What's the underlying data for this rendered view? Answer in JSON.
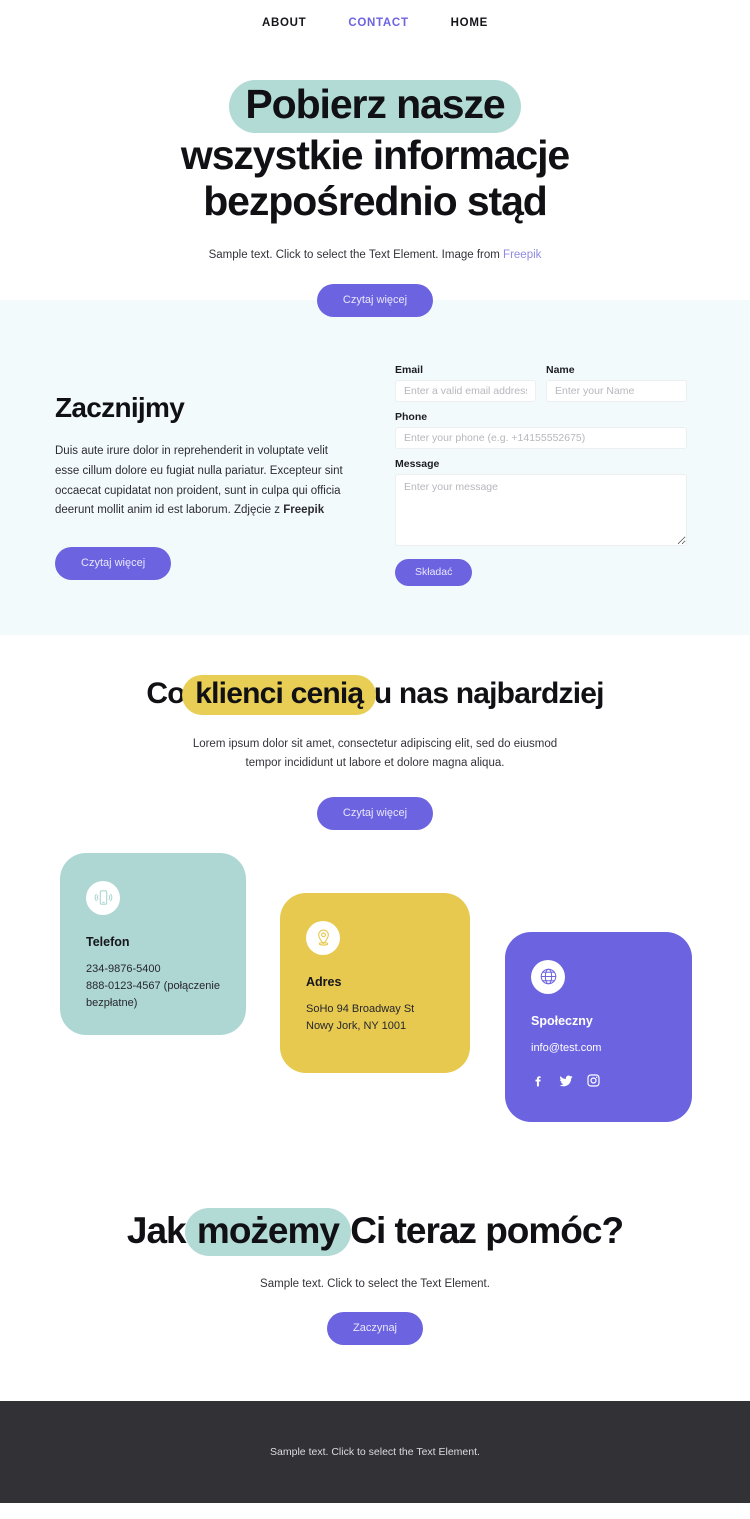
{
  "nav": {
    "items": [
      {
        "label": "ABOUT",
        "active": false
      },
      {
        "label": "CONTACT",
        "active": true
      },
      {
        "label": "HOME",
        "active": false
      }
    ]
  },
  "hero": {
    "title_highlight": "Pobierz nasze",
    "title_rest": "wszystkie informacje bezpośrednio stąd",
    "subtitle": "Sample text. Click to select the Text Element. Image from",
    "subtitle_link": "Freepik",
    "button": "Czytaj więcej",
    "highlight_color": "#b3dbd6"
  },
  "contact": {
    "heading": "Zacznijmy",
    "paragraph": "Duis aute irure dolor in reprehenderit in voluptate velit esse cillum dolore eu fugiat nulla pariatur. Excepteur sint occaecat cupidatat non proident, sunt in culpa qui officia deerunt mollit anim id est laborum. Zdjęcie z",
    "paragraph_bold": "Freepik",
    "button": "Czytaj więcej",
    "background": "#f3fafb",
    "form": {
      "email_label": "Email",
      "email_placeholder": "Enter a valid email address",
      "email_value": "",
      "name_label": "Name",
      "name_placeholder": "Enter your Name",
      "name_value": "",
      "phone_label": "Phone",
      "phone_placeholder": "Enter your phone (e.g. +14155552675)",
      "phone_value": "",
      "message_label": "Message",
      "message_placeholder": "Enter your message",
      "message_value": "",
      "submit_label": "Składać"
    }
  },
  "testimonials": {
    "title_before": "Co ",
    "title_highlight": "klienci cenią",
    "title_after": " u nas najbardziej",
    "subtitle": "Lorem ipsum dolor sit amet, consectetur adipiscing elit, sed do eiusmod tempor incididunt ut labore et dolore magna aliqua.",
    "button": "Czytaj więcej",
    "highlight_color": "#e8ce55"
  },
  "cards": [
    {
      "icon": "mobile-phone-icon",
      "title": "Telefon",
      "text": "234-9876-5400\n888-0123-4567 (połączenie bezpłatne)",
      "color": "#aed7d3"
    },
    {
      "icon": "location-pin-icon",
      "title": "Adres",
      "text": "SoHo 94 Broadway St Nowy Jork, NY 1001",
      "color": "#e6c94e"
    },
    {
      "icon": "globe-icon",
      "title": "Społeczny",
      "text": "info@test.com",
      "color": "#6c63e0",
      "socials": [
        "facebook-icon",
        "twitter-icon",
        "instagram-icon"
      ]
    }
  ],
  "cta": {
    "title_before": "Jak ",
    "title_highlight": "możemy",
    "title_after": " Ci teraz pomóc?",
    "subtitle": "Sample text. Click to select the Text Element.",
    "button": "Zaczynaj",
    "highlight_color": "#b3dbd6"
  },
  "footer": {
    "text": "Sample text. Click to select the Text Element.",
    "background": "#323236"
  }
}
